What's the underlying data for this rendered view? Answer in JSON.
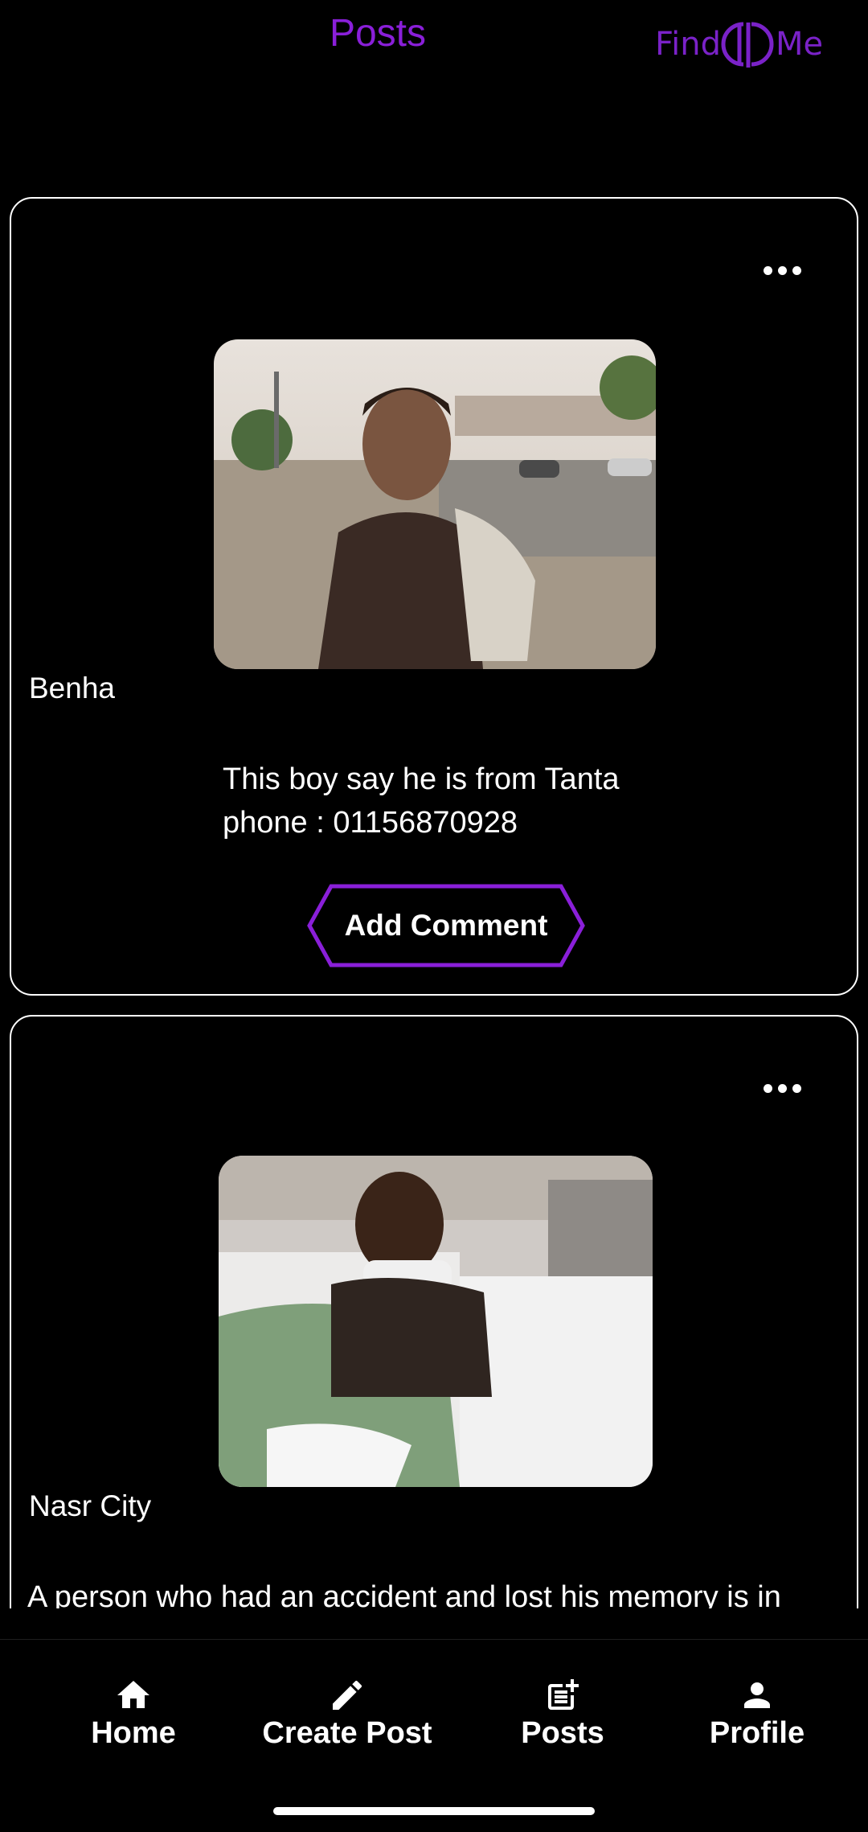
{
  "app_bar": {
    "title": "Posts",
    "logo_text": "Find Me"
  },
  "posts": [
    {
      "location": "Benha",
      "description_lines": [
        "This boy say he is from Tanta",
        "phone : 01156870928"
      ],
      "comment_label": "Add Comment",
      "image_icon": "photo-of-boy-icon"
    },
    {
      "location": "Nasr City",
      "description_lines": [
        "A person who had an accident and lost his memory is in"
      ],
      "image_icon": "photo-of-hospital-patient-icon"
    }
  ],
  "bottom_nav": {
    "items": [
      {
        "label": "Home",
        "icon": "home-icon"
      },
      {
        "label": "Create Post",
        "icon": "pencil-icon"
      },
      {
        "label": "Posts",
        "icon": "post-add-icon"
      },
      {
        "label": "Profile",
        "icon": "person-icon"
      }
    ]
  },
  "colors": {
    "accent": "#8a1fd9",
    "background": "#000000",
    "text": "#ffffff"
  }
}
